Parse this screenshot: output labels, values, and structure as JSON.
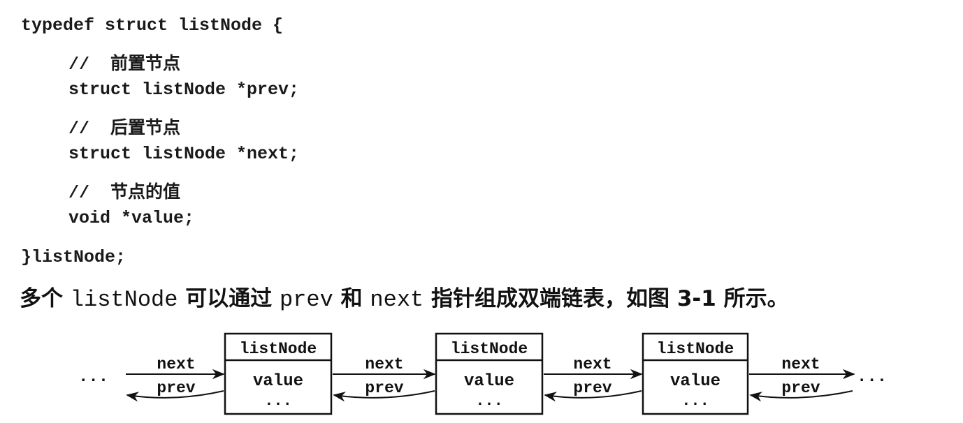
{
  "code": {
    "line1": "typedef struct listNode {",
    "comment_prev": "//  前置节点",
    "field_prev": "struct listNode *prev;",
    "comment_next": "//  后置节点",
    "field_next": "struct listNode *next;",
    "comment_value": "//  节点的值",
    "field_value": "void *value;",
    "closing": "}listNode;"
  },
  "caption": {
    "part1": "多个 ",
    "code1": "listNode",
    "part2": " 可以通过 ",
    "code2": "prev",
    "part3": " 和 ",
    "code3": "next",
    "part4": " 指针组成双端链表，如图 3-1 所示。"
  },
  "diagram": {
    "node_title": "listNode",
    "node_value": "value",
    "node_dots": "...",
    "edge_next": "next",
    "edge_prev": "prev",
    "left_ellipsis": "...",
    "right_ellipsis": "...",
    "node_count": 3
  }
}
